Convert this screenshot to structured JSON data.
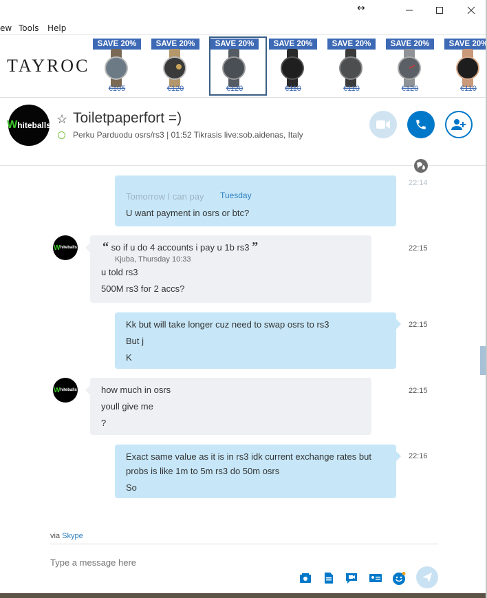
{
  "window": {
    "drag_glyph": "↔",
    "controls": [
      "minimize-icon",
      "maximize-icon",
      "close-icon"
    ]
  },
  "menu": {
    "items": [
      "ew",
      "Tools",
      "Help"
    ]
  },
  "ad": {
    "brand": "TAYROC",
    "items": [
      {
        "badge": "SAVE 20%",
        "price": "€105",
        "face": "#6c7a86",
        "strap": "#7a6a55"
      },
      {
        "badge": "SAVE 20%",
        "price": "€120",
        "face": "#3a3a3a",
        "strap": "#b4976a"
      },
      {
        "badge": "SAVE 20%",
        "price": "€120",
        "face": "#4a4f55",
        "strap": "#555b62"
      },
      {
        "badge": "SAVE 20%",
        "price": "€110",
        "face": "#1f1f1f",
        "strap": "#2a2a2a"
      },
      {
        "badge": "SAVE 20%",
        "price": "€110",
        "face": "#4c4e50",
        "strap": "#3b3b3b"
      },
      {
        "badge": "SAVE 20%",
        "price": "€120",
        "face": "#5b6066",
        "strap": "#8f9397"
      },
      {
        "badge": "SAVE 20%",
        "price": "€110",
        "face": "#1d1d1d",
        "strap": "#c9997a"
      }
    ]
  },
  "conversation": {
    "avatar_w": "W",
    "avatar_rest": "hiteballs",
    "title": "Toiletpaperfort =)",
    "mood": "Perku Parduodu osrs/rs3  |  01:52 Tikrasis live:sob.aidenas, Italy",
    "accent": "#0078c9",
    "video_bg": "#cfe3f0"
  },
  "messages": {
    "day": "Tuesday",
    "faded_top": "Tomorrow I can pay",
    "faded_time": "22:14",
    "m0": {
      "lines": [
        "U want payment in osrs or btc?"
      ]
    },
    "m1": {
      "quote_text": "so if u do 4 accounts i pay u 1b rs3",
      "quote_meta": "Kjuba, Thursday 10:33",
      "lines": [
        "u told rs3",
        "500M rs3 for 2 accs?"
      ],
      "time": "22:15"
    },
    "m2": {
      "lines": [
        "Kk but will take longer cuz need to swap osrs to rs3",
        "But j",
        "K"
      ],
      "time": "22:15"
    },
    "m3": {
      "lines": [
        "how much in osrs",
        "youll give me",
        "?"
      ],
      "time": "22:15"
    },
    "m4": {
      "lines": [
        "Exact same value as it is in rs3 idk current exchange rates but",
        "probs is like 1m to 5m rs3 do 50m osrs",
        "So"
      ],
      "time": "22:16"
    }
  },
  "compose": {
    "via_prefix": "via",
    "via_link": "Skype",
    "placeholder": "Type a message here",
    "tools": [
      "media-icon",
      "file-icon",
      "video-message-icon",
      "contact-card-icon",
      "emoticon-icon"
    ]
  }
}
